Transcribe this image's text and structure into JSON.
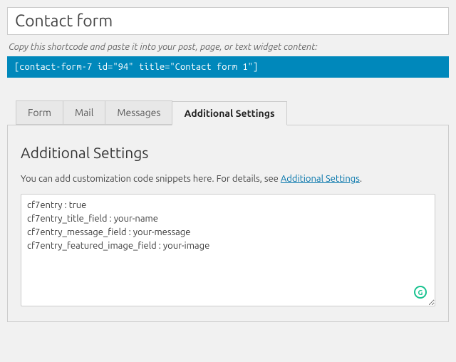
{
  "title_value": "Contact form",
  "info_text": "Copy this shortcode and paste it into your post, page, or text widget content:",
  "shortcode": "[contact-form-7 id=\"94\" title=\"Contact form 1\"]",
  "tabs": {
    "form": "Form",
    "mail": "Mail",
    "messages": "Messages",
    "additional": "Additional Settings"
  },
  "panel": {
    "heading": "Additional Settings",
    "help_prefix": "You can add customization code snippets here. For details, see ",
    "help_link_text": "Additional Settings",
    "help_suffix": ".",
    "textarea_value": "cf7entry : true\ncf7entry_title_field : your-name\ncf7entry_message_field : your-message\ncf7entry_featured_image_field : your-image"
  }
}
